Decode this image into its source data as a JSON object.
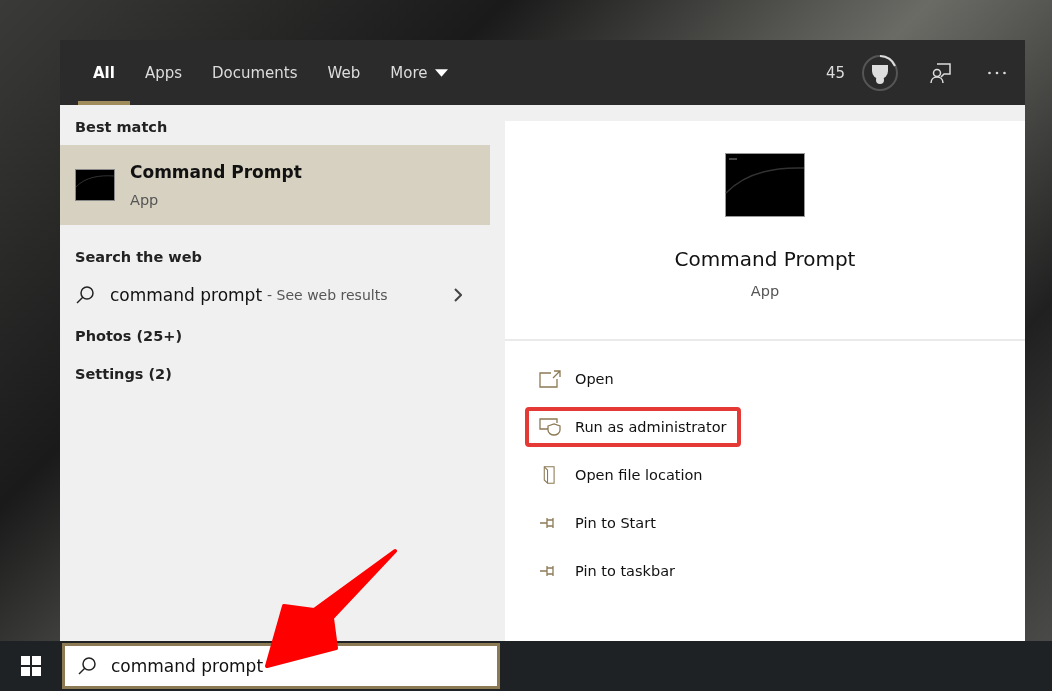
{
  "tabs": [
    {
      "label": "All",
      "selected": true,
      "kind": "plain"
    },
    {
      "label": "Apps",
      "selected": false,
      "kind": "plain"
    },
    {
      "label": "Documents",
      "selected": false,
      "kind": "plain"
    },
    {
      "label": "Web",
      "selected": false,
      "kind": "plain"
    },
    {
      "label": "More",
      "selected": false,
      "kind": "dropdown"
    }
  ],
  "points": "45",
  "best_match": {
    "heading": "Best match",
    "title": "Command Prompt",
    "subtitle": "App",
    "selected": true
  },
  "web": {
    "heading": "Search the web",
    "query": "command prompt",
    "suffix": "- See web results"
  },
  "categories": [
    "Photos (25+)",
    "Settings (2)"
  ],
  "preview": {
    "title": "Command Prompt",
    "subtitle": "App"
  },
  "actions": [
    {
      "label": "Open",
      "kind": "open",
      "highlighted": false
    },
    {
      "label": "Run as administrator",
      "kind": "admin",
      "highlighted": true
    },
    {
      "label": "Open file location",
      "kind": "location",
      "highlighted": false
    },
    {
      "label": "Pin to Start",
      "kind": "pin",
      "highlighted": false
    },
    {
      "label": "Pin to taskbar",
      "kind": "pin",
      "highlighted": false
    }
  ],
  "taskbar": {
    "search_value": "command prompt"
  },
  "annotation_arrow": true
}
